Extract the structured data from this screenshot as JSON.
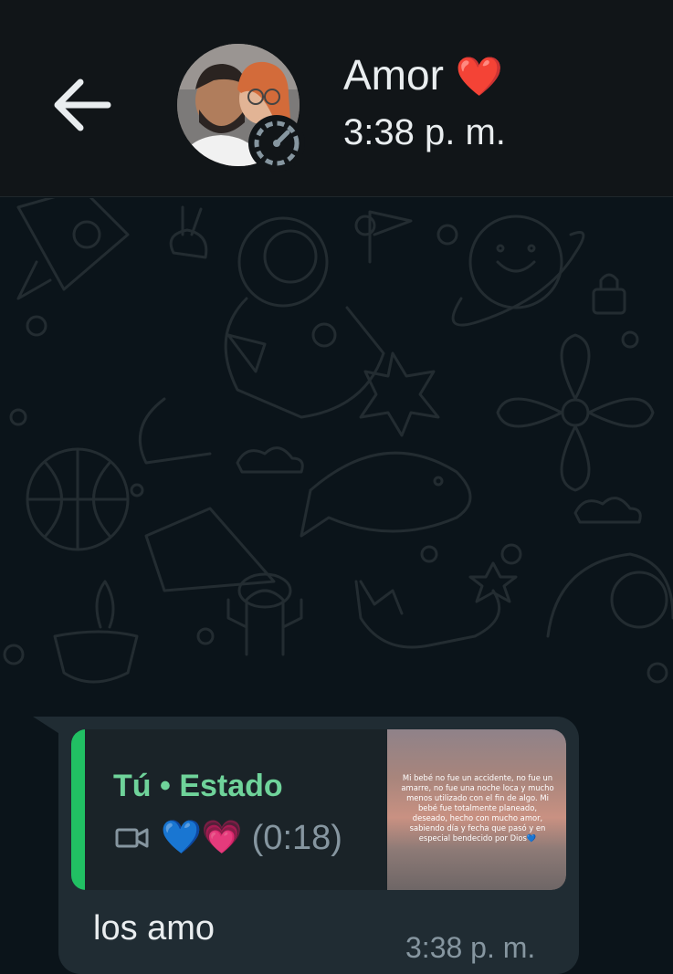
{
  "header": {
    "contact_name": "Amor",
    "contact_emoji": "❤️",
    "last_seen": "3:38 p. m.",
    "back_icon": "arrow-left-icon",
    "avatar_icon": "avatar-photo",
    "status_icon": "status-ring-icon"
  },
  "message": {
    "reply": {
      "author": "Tú • Estado",
      "media_icon": "video-icon",
      "emoji_blue": "💙",
      "emoji_pink": "💗",
      "duration": "(0:18)",
      "thumbnail_text": "Mi bebé no fue un accidente, no fue un amarre, no fue una noche loca y mucho menos utilizado con el fin de algo. Mi bebé fue totalmente planeado, deseado, hecho con mucho amor, sabiendo día y fecha que pasó y en especial bendecido por Dios💙"
    },
    "text": "los amo",
    "time": "3:38 p. m."
  },
  "colors": {
    "header_bg": "#111518",
    "chat_bg": "#0b141a",
    "bubble_bg": "#202c33",
    "quote_bar": "#21c063",
    "quote_author": "#6fd39a",
    "meta_text": "#8696a0",
    "primary_text": "#e9edef"
  }
}
